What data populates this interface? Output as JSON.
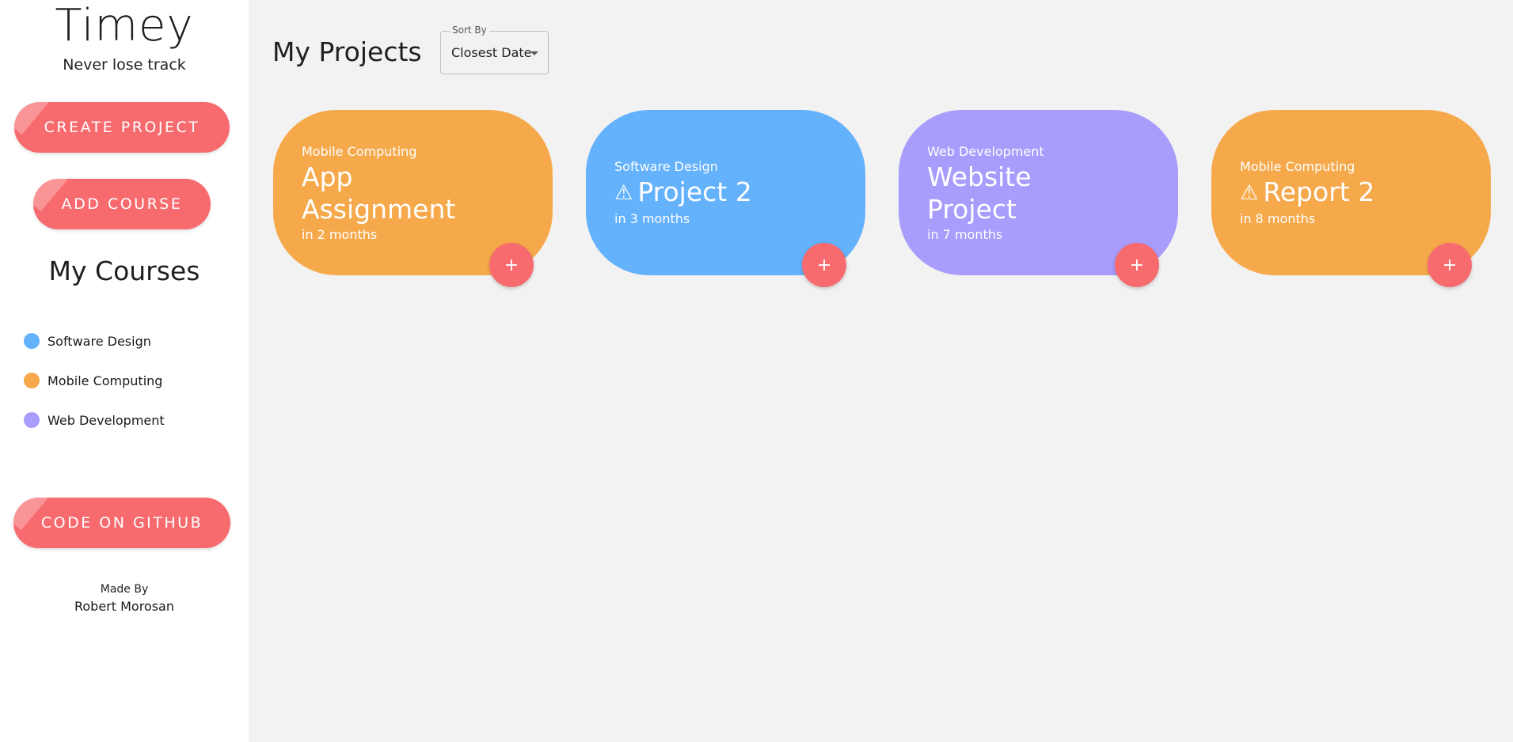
{
  "sidebar": {
    "app_title": "Timey",
    "tagline": "Never lose track",
    "create_project_label": "CREATE PROJECT",
    "add_course_label": "ADD COURSE",
    "courses_heading": "My Courses",
    "courses": [
      {
        "name": "Software Design",
        "color": "#64b1fc"
      },
      {
        "name": "Mobile Computing",
        "color": "#f6a94b"
      },
      {
        "name": "Web Development",
        "color": "#a89cfc"
      }
    ],
    "github_label": "CODE ON GITHUB",
    "made_by_label": "Made By",
    "author": "Robert Morosan"
  },
  "main": {
    "title": "My Projects",
    "sort": {
      "label": "Sort By",
      "value": "Closest Date"
    },
    "projects": [
      {
        "course": "Mobile Computing",
        "title": "App Assignment",
        "due": "in 2 months",
        "warning": false,
        "color": "#f6a94b",
        "add_icon": "+"
      },
      {
        "course": "Software Design",
        "title": "Project 2",
        "due": "in 3 months",
        "warning": true,
        "color": "#64b1fc",
        "add_icon": "+"
      },
      {
        "course": "Web Development",
        "title": "Website Project",
        "due": "in 7 months",
        "warning": false,
        "color": "#a89cfc",
        "add_icon": "+"
      },
      {
        "course": "Mobile Computing",
        "title": "Report 2",
        "due": "in 8 months",
        "warning": true,
        "color": "#f6a94b",
        "add_icon": "+"
      }
    ]
  },
  "colors": {
    "accent": "#f76b6f",
    "background": "#f2f2f2"
  }
}
